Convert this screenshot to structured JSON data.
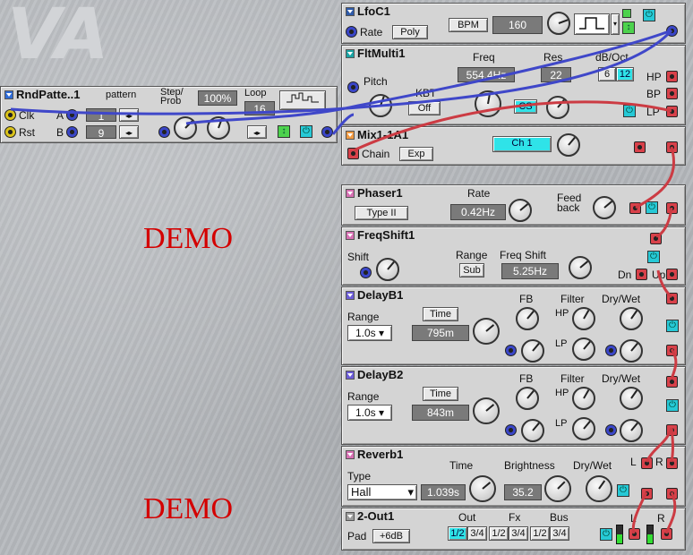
{
  "watermark": "VA",
  "demo_label": "DEMO",
  "colors": {
    "cable_blue": "#3f47c9",
    "cable_red": "#cc3b43",
    "accent_cyan": "#2fe3e8",
    "title_blue": "#2e5aa8",
    "title_pink": "#d66fb2",
    "title_orange": "#f09a42"
  },
  "rnd": {
    "title": "RndPatte..1",
    "pattern": "pattern",
    "step_prob": "Step/\nProb",
    "step_value": "100%",
    "loop": "Loop",
    "loop_value": "16",
    "clk": "Clk",
    "a": "A",
    "a_value": "1",
    "rst": "Rst",
    "b": "B",
    "b_value": "9"
  },
  "lfo": {
    "title": "LfoC1",
    "rate": "Rate",
    "poly": "Poly",
    "bpm": "BPM",
    "bpm_value": "160"
  },
  "flt": {
    "title": "FltMulti1",
    "freq": "Freq",
    "freq_value": "554.4Hz",
    "res": "Res",
    "res_value": "22",
    "db": "dB/Oct",
    "db6": "6",
    "db12": "12",
    "pitch": "Pitch",
    "kbt": "KBT",
    "kbt_value": "Off",
    "hp": "HP",
    "bp": "BP",
    "lp": "LP"
  },
  "mix": {
    "title": "Mix1-1A1",
    "chain": "Chain",
    "exp": "Exp",
    "ch": "Ch 1"
  },
  "phaser": {
    "title": "Phaser1",
    "rate": "Rate",
    "rate_value": "0.42Hz",
    "type": "Type II",
    "feed": "Feed\nback"
  },
  "freqshift": {
    "title": "FreqShift1",
    "shift": "Shift",
    "range": "Range",
    "range_value": "Sub",
    "freq": "Freq Shift",
    "freq_value": "5.25Hz",
    "dn": "Dn",
    "up": "Up"
  },
  "delay1": {
    "title": "DelayB1",
    "range": "Range",
    "range_value": "1.0s",
    "time": "Time",
    "time_value": "795m",
    "fb": "FB",
    "filter": "Filter",
    "drywet": "Dry/Wet",
    "hp": "HP",
    "lp": "LP"
  },
  "delay2": {
    "title": "DelayB2",
    "range": "Range",
    "range_value": "1.0s",
    "time": "Time",
    "time_value": "843m",
    "fb": "FB",
    "filter": "Filter",
    "drywet": "Dry/Wet",
    "hp": "HP",
    "lp": "LP"
  },
  "reverb": {
    "title": "Reverb1",
    "type": "Type",
    "type_value": "Hall",
    "time": "Time",
    "time_value": "1.039s",
    "brightness": "Brightness",
    "bright_value": "35.2",
    "drywet": "Dry/Wet",
    "l": "L",
    "r": "R"
  },
  "out": {
    "title": "2-Out1",
    "pad": "Pad",
    "pad_value": "+6dB",
    "out": "Out",
    "fx": "Fx",
    "bus": "Bus",
    "o12": "1/2",
    "o34": "3/4",
    "f12": "1/2",
    "f34": "3/4",
    "b12": "1/2",
    "b34": "3/4",
    "l": "L",
    "r": "R"
  }
}
